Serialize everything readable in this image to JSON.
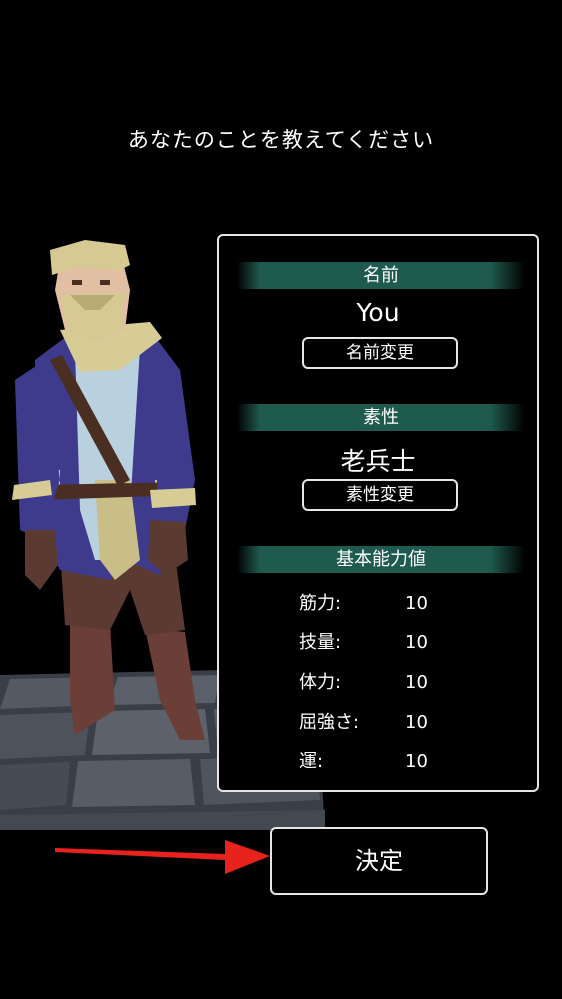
{
  "prompt": "あなたのことを教えてください",
  "name_section": {
    "header": "名前",
    "value": "You",
    "button_label": "名前変更"
  },
  "trait_section": {
    "header": "素性",
    "value": "老兵士",
    "button_label": "素性変更"
  },
  "stats_section": {
    "header": "基本能力値",
    "stats": [
      {
        "label": "筋力:",
        "value": "10"
      },
      {
        "label": "技量:",
        "value": "10"
      },
      {
        "label": "体力:",
        "value": "10"
      },
      {
        "label": "屈強さ:",
        "value": "10"
      },
      {
        "label": "運:",
        "value": "10"
      }
    ]
  },
  "confirm_button": "決定",
  "colors": {
    "header_bg": "#1f5a4e",
    "border": "#e6e6e6",
    "arrow": "#e8231d",
    "coat": "#3e3a8c",
    "floor": "#4a4f58"
  }
}
